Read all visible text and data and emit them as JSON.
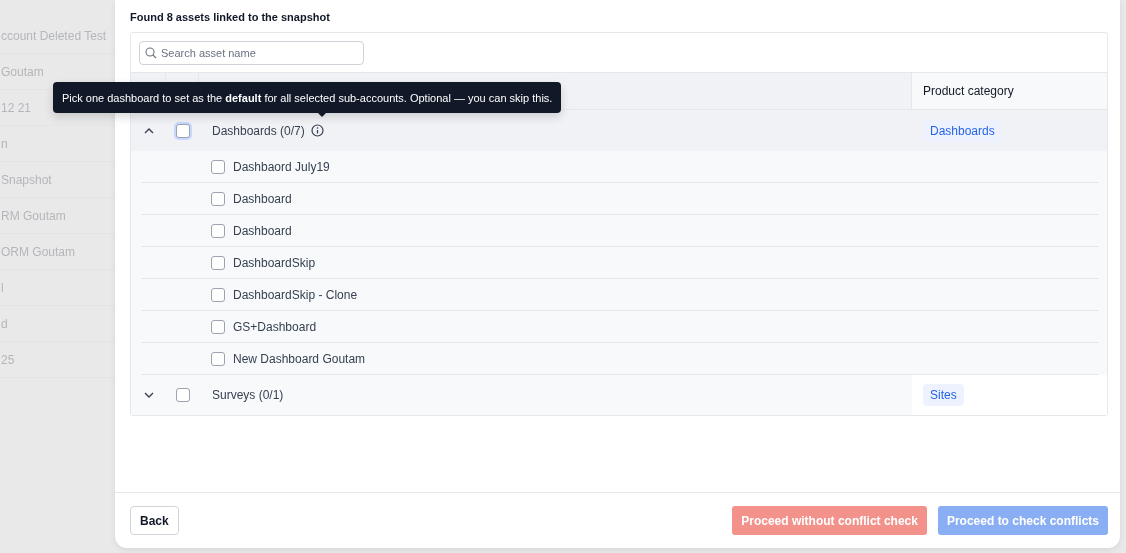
{
  "background_list": [
    {
      "text": "ccount Deleted Test"
    },
    {
      "text": "Goutam"
    },
    {
      "text": "12 21"
    },
    {
      "text": "n"
    },
    {
      "text": "Snapshot"
    },
    {
      "text": "RM Goutam"
    },
    {
      "text": "ORM Goutam"
    },
    {
      "text": "l"
    },
    {
      "text": "d"
    },
    {
      "text": "25"
    }
  ],
  "heading": "Found 8 assets linked to the snapshot",
  "search": {
    "placeholder": "Search asset name"
  },
  "table": {
    "category_header": "Product category",
    "groups": [
      {
        "name": "Dashboards (0/7)",
        "expanded": true,
        "checked": false,
        "focused": true,
        "category": "Dashboards",
        "tooltip": "Pick one dashboard to set as the **default** for all selected sub-accounts. Optional — you can skip this.",
        "children": [
          {
            "name": "Dashbaord July19",
            "checked": false
          },
          {
            "name": "Dashboard",
            "checked": false
          },
          {
            "name": "Dashboard",
            "checked": false
          },
          {
            "name": "DashboardSkip",
            "checked": false
          },
          {
            "name": "DashboardSkip - Clone",
            "checked": false
          },
          {
            "name": "GS+Dashboard",
            "checked": false
          },
          {
            "name": "New Dashboard Goutam",
            "checked": false
          }
        ]
      },
      {
        "name": "Surveys (0/1)",
        "expanded": false,
        "checked": false,
        "focused": false,
        "category": "Sites"
      }
    ]
  },
  "footer": {
    "back": "Back",
    "actions": [
      {
        "label": "Proceed without conflict check",
        "kind": "danger",
        "disabled": true
      },
      {
        "label": "Proceed to check conflicts",
        "kind": "primary",
        "disabled": true
      }
    ]
  }
}
